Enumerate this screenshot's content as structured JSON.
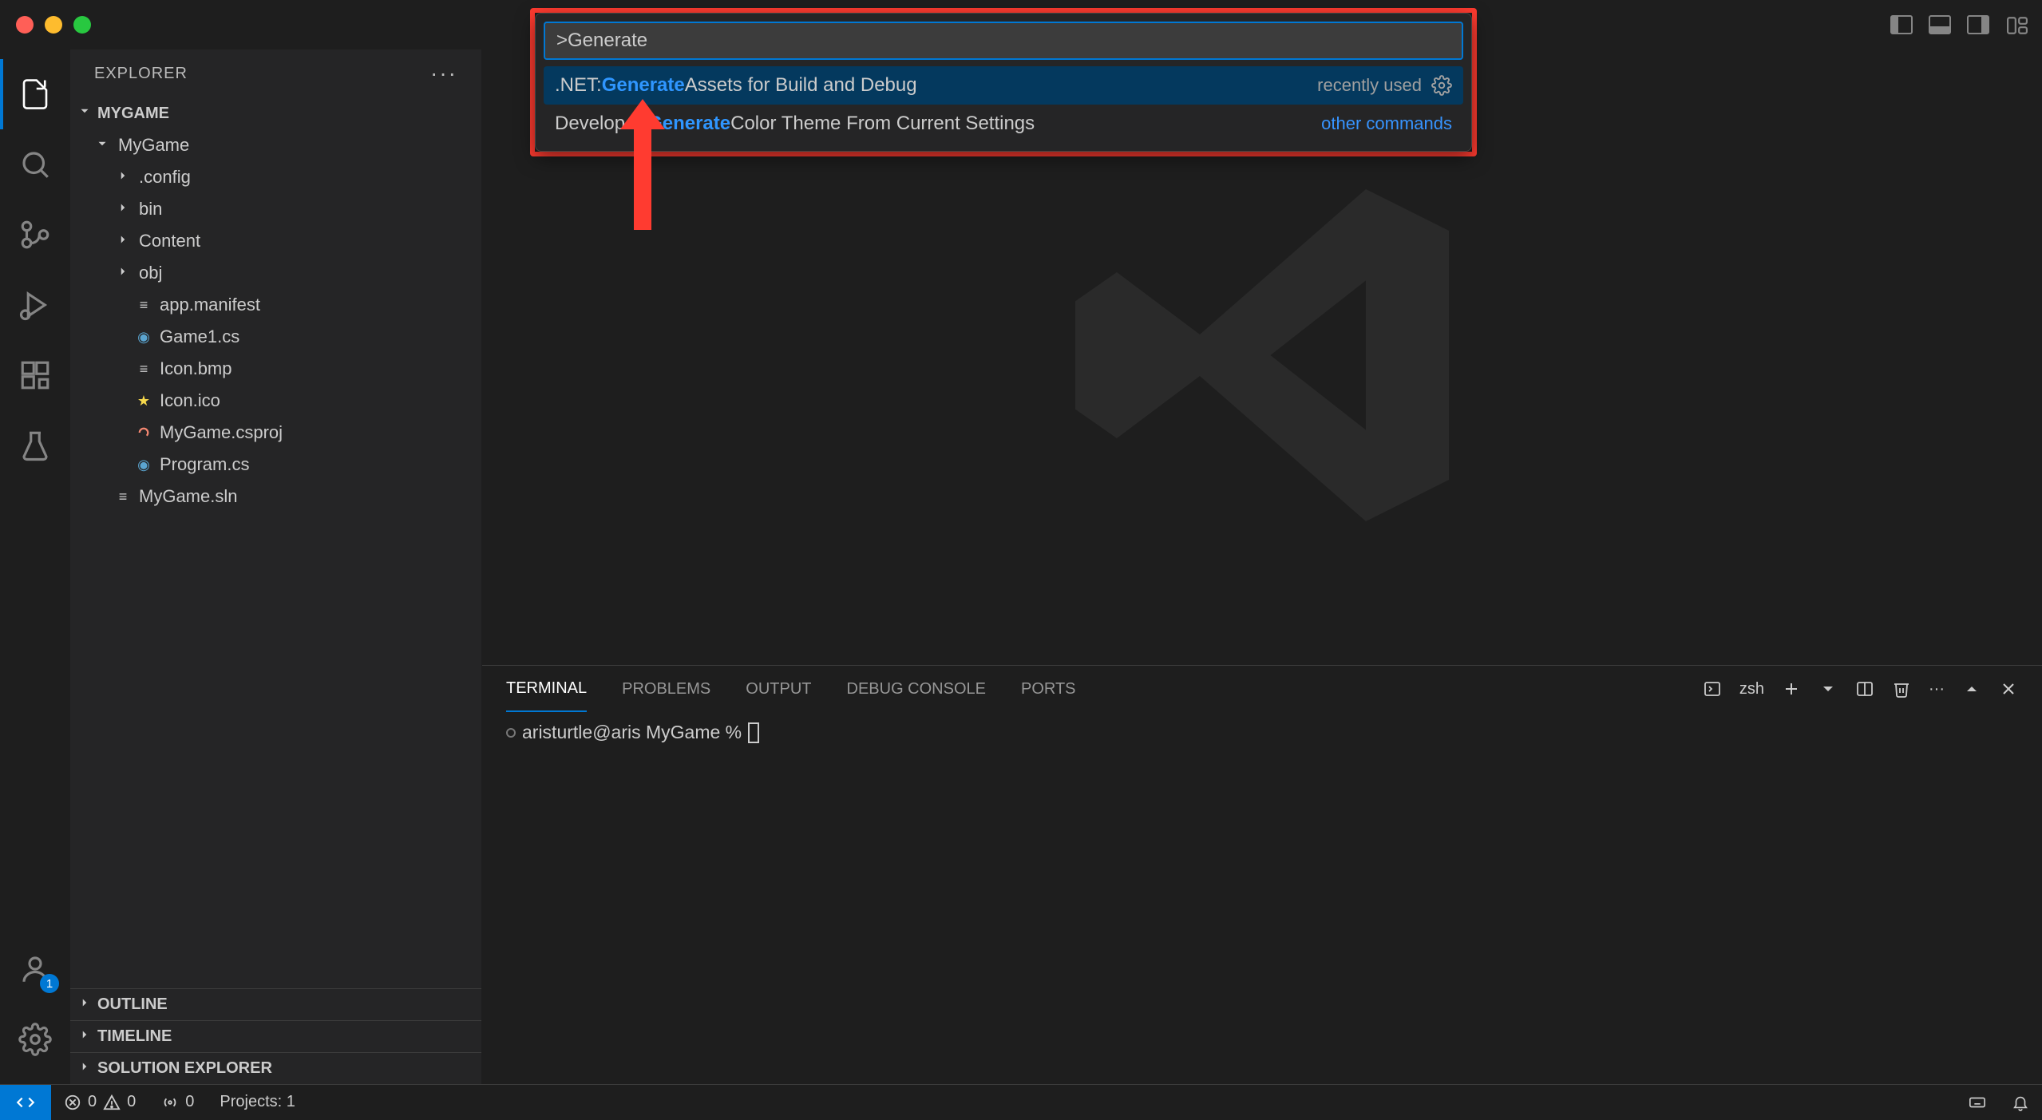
{
  "sidebar": {
    "title": "EXPLORER",
    "root": "MYGAME",
    "tree": [
      {
        "label": "MyGame",
        "kind": "folder-open",
        "depth": 0
      },
      {
        "label": ".config",
        "kind": "folder",
        "depth": 1
      },
      {
        "label": "bin",
        "kind": "folder",
        "depth": 1
      },
      {
        "label": "Content",
        "kind": "folder",
        "depth": 1
      },
      {
        "label": "obj",
        "kind": "folder",
        "depth": 1
      },
      {
        "label": "app.manifest",
        "kind": "file",
        "depth": 1
      },
      {
        "label": "Game1.cs",
        "kind": "cs",
        "depth": 1
      },
      {
        "label": "Icon.bmp",
        "kind": "file",
        "depth": 1
      },
      {
        "label": "Icon.ico",
        "kind": "star",
        "depth": 1
      },
      {
        "label": "MyGame.csproj",
        "kind": "csproj",
        "depth": 1
      },
      {
        "label": "Program.cs",
        "kind": "cs",
        "depth": 1
      },
      {
        "label": "MyGame.sln",
        "kind": "file",
        "depth": 0
      }
    ],
    "collapsed": [
      "OUTLINE",
      "TIMELINE",
      "SOLUTION EXPLORER"
    ]
  },
  "palette": {
    "input": ">Generate",
    "items": [
      {
        "prefix": ".NET: ",
        "match": "Generate",
        "suffix": " Assets for Build and Debug",
        "meta": "recently used",
        "gear": true,
        "selected": true
      },
      {
        "prefix": "Developer: ",
        "match": "Generate",
        "suffix": " Color Theme From Current Settings",
        "meta": "other commands",
        "gear": false,
        "selected": false
      }
    ]
  },
  "panel": {
    "tabs": [
      "TERMINAL",
      "PROBLEMS",
      "OUTPUT",
      "DEBUG CONSOLE",
      "PORTS"
    ],
    "active": 0,
    "shell": "zsh",
    "prompt": "aristurtle@aris MyGame %"
  },
  "status": {
    "errors": "0",
    "warnings": "0",
    "ports": "0",
    "projects": "Projects: 1"
  },
  "accounts_badge": "1"
}
